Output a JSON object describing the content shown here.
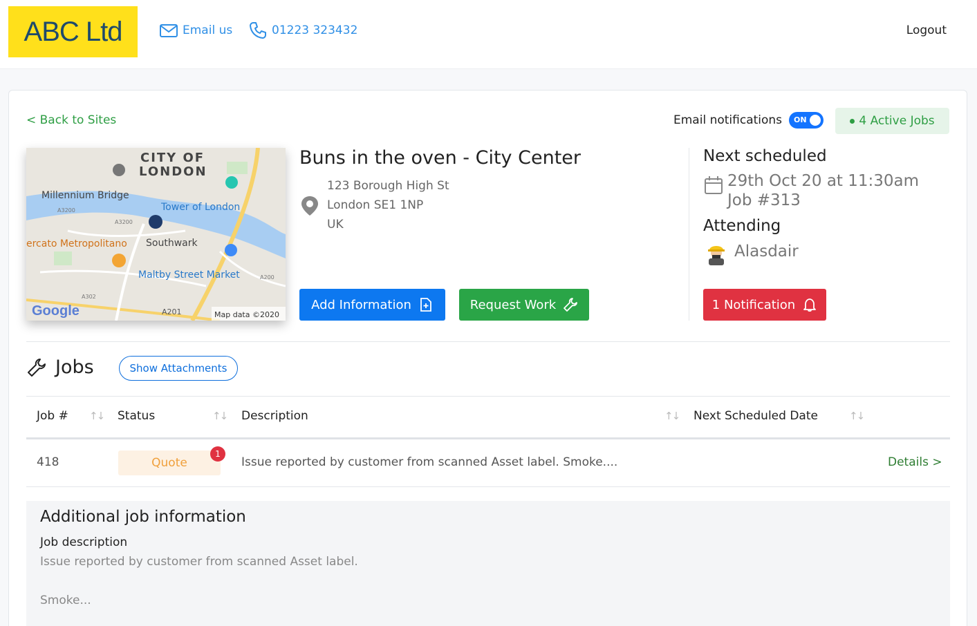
{
  "header": {
    "logo_text": "ABC Ltd",
    "email_label": "Email us",
    "phone_label": "01223 323432",
    "logout_label": "Logout"
  },
  "nav": {
    "back_label": "< Back to Sites"
  },
  "notifications": {
    "label": "Email notifications",
    "toggle_state": "ON"
  },
  "active_jobs": {
    "label": "4 Active Jobs",
    "color": "#2e9e44"
  },
  "map": {
    "labels": [
      "CITY OF",
      "LONDON",
      "Millennium Bridge",
      "Tower of London",
      "ercato Metropolitano",
      "Southwark",
      "Maltby Street Market",
      "A3200",
      "A3200",
      "A302",
      "A201",
      "A200",
      "Google",
      "Map data ©2020"
    ]
  },
  "site": {
    "title": "Buns in the oven - City Center",
    "address_lines": [
      "123 Borough High St",
      "London SE1 1NP",
      "UK"
    ]
  },
  "actions": {
    "add_info_label": "Add Information",
    "request_work_label": "Request Work",
    "notification_label": "1 Notification"
  },
  "schedule": {
    "next_title": "Next scheduled",
    "date": "29th Oct 20 at 11:30am",
    "job": "Job #313",
    "attending_title": "Attending",
    "attendee": "Alasdair"
  },
  "jobs": {
    "title": "Jobs",
    "show_attachments_label": "Show Attachments",
    "columns": [
      "Job #",
      "Status",
      "Description",
      "Next Scheduled Date"
    ],
    "rows": [
      {
        "job_no": "418",
        "status": "Quote",
        "badge": "1",
        "description": "Issue reported by customer from scanned Asset label. Smoke....",
        "link": "Details >"
      }
    ]
  },
  "additional_info": {
    "title": "Additional job information",
    "label": "Job description",
    "text": "Issue reported by customer from scanned Asset label.",
    "more": "Smoke..."
  },
  "colors": {
    "brand_yellow": "#ffe01b",
    "primary_blue": "#0d78f0",
    "success_green": "#2aa547",
    "danger_red": "#e03241",
    "quote_orange": "#f0a03c"
  }
}
